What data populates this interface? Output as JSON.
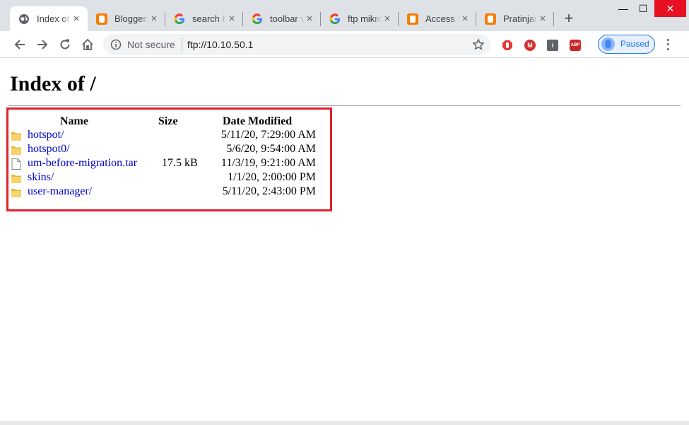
{
  "browser": {
    "tabs": [
      {
        "title": "Index of /",
        "favicon": "globe-icon",
        "active": true
      },
      {
        "title": "Blogger: ",
        "favicon": "blogger-icon",
        "active": false
      },
      {
        "title": "search b",
        "favicon": "google-icon",
        "active": false
      },
      {
        "title": "toolbar v",
        "favicon": "google-icon",
        "active": false
      },
      {
        "title": "ftp mikro",
        "favicon": "google-icon",
        "active": false
      },
      {
        "title": "Access F",
        "favicon": "blogger-icon",
        "active": false
      },
      {
        "title": "Pratinjau",
        "favicon": "blogger-icon",
        "active": false
      }
    ],
    "new_tab": "+",
    "window_controls": {
      "minimize": "—",
      "maximize": "☐",
      "close": "✕"
    },
    "omnibox": {
      "security_text": "Not secure",
      "url": "ftp://10.10.50.1"
    },
    "extensions": [
      {
        "name": "stop-hand-icon",
        "color": "#e53935"
      },
      {
        "name": "mega-icon",
        "color": "#d32f2f",
        "label": "M"
      },
      {
        "name": "info-icon",
        "color": "#5f6368",
        "label": "i"
      },
      {
        "name": "abp-icon",
        "color": "#c62828",
        "label": "ABP"
      }
    ],
    "profile": {
      "label": "Paused"
    }
  },
  "page": {
    "heading": "Index of /",
    "columns": {
      "name": "Name",
      "size": "Size",
      "date": "Date Modified"
    },
    "entries": [
      {
        "name": "hotspot/",
        "type": "folder",
        "size": "",
        "date": "5/11/20, 7:29:00 AM"
      },
      {
        "name": "hotspot0/",
        "type": "folder",
        "size": "",
        "date": "5/6/20, 9:54:00 AM"
      },
      {
        "name": "um-before-migration.tar",
        "type": "file",
        "size": "17.5 kB",
        "date": "11/3/19, 9:21:00 AM"
      },
      {
        "name": "skins/",
        "type": "folder",
        "size": "",
        "date": "1/1/20, 2:00:00 PM"
      },
      {
        "name": "user-manager/",
        "type": "folder",
        "size": "",
        "date": "5/11/20, 2:43:00 PM"
      }
    ],
    "highlight_color": "#e0202a"
  }
}
